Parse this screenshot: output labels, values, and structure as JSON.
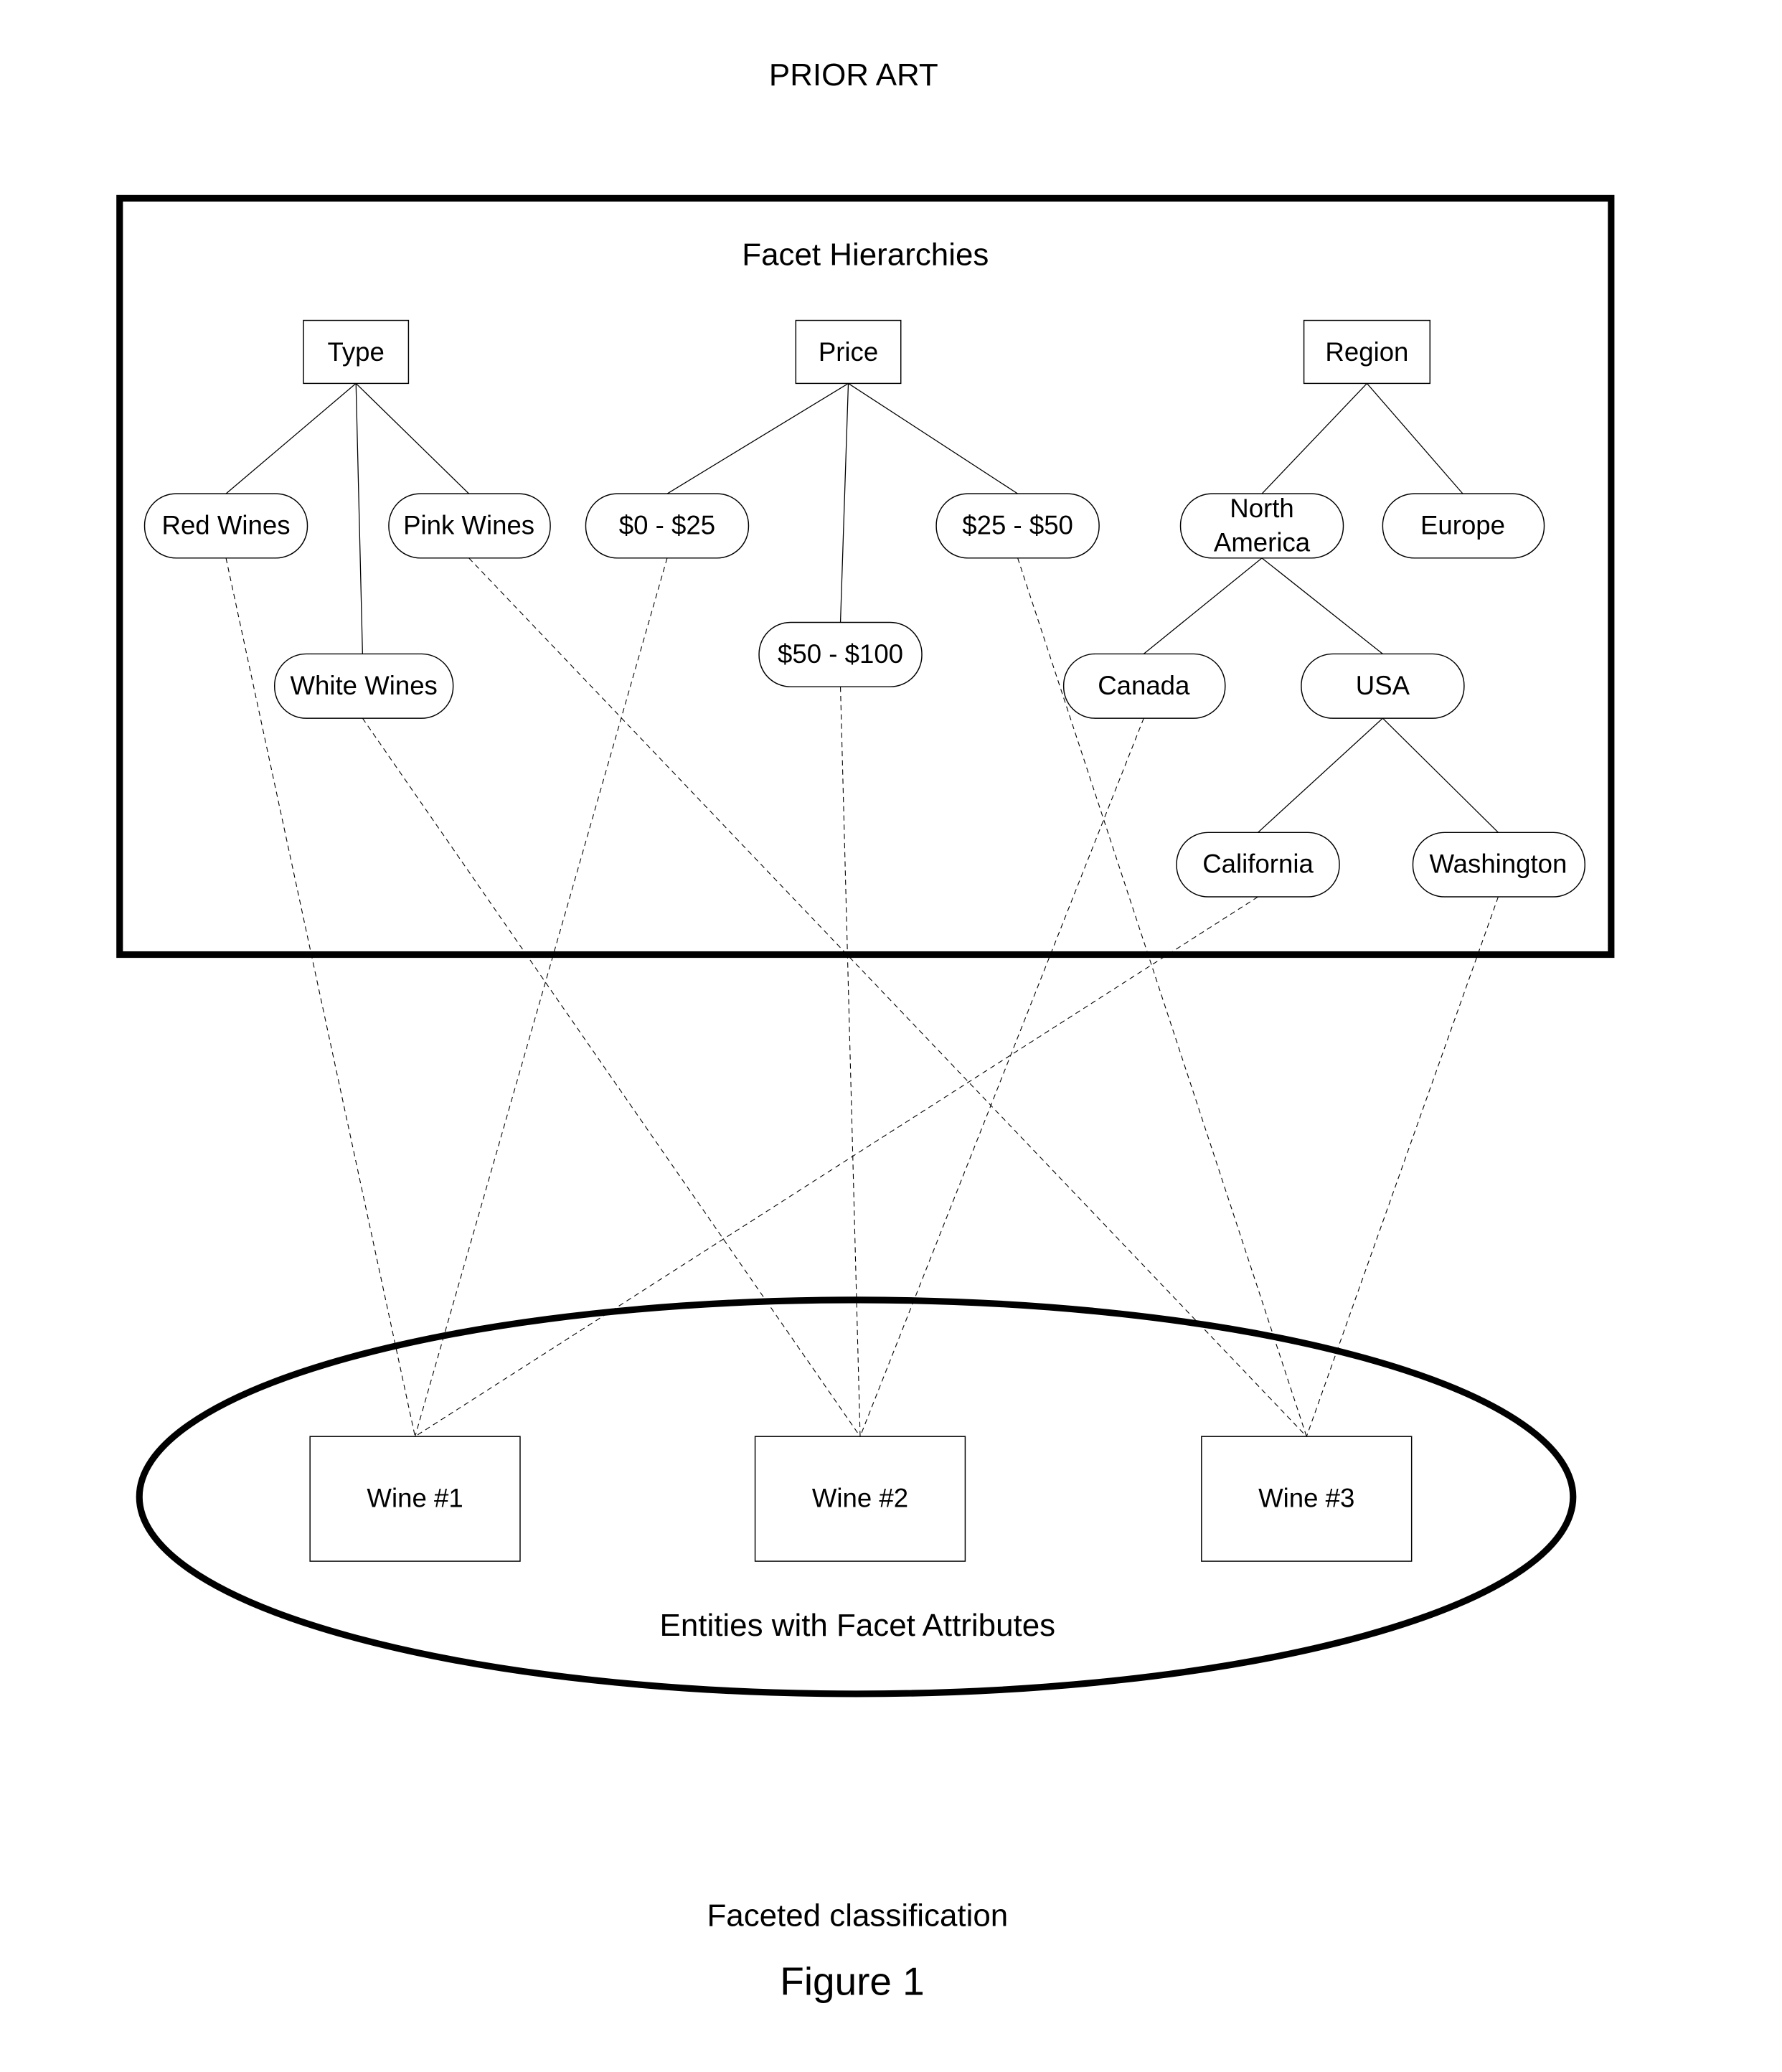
{
  "header": {
    "prior_art": "PRIOR ART"
  },
  "facet_box": {
    "title": "Facet Hierarchies"
  },
  "facets": {
    "type": "Type",
    "price": "Price",
    "region": "Region"
  },
  "values": {
    "red_wines": "Red Wines",
    "pink_wines": "Pink Wines",
    "white_wines": "White Wines",
    "p0_25": "$0 - $25",
    "p25_50": "$25 - $50",
    "p50_100": "$50 - $100",
    "north_america_1": "North",
    "north_america_2": "America",
    "europe": "Europe",
    "canada": "Canada",
    "usa": "USA",
    "california": "California",
    "washington": "Washington"
  },
  "entities": {
    "title": "Entities with Facet Attributes",
    "wine1": "Wine #1",
    "wine2": "Wine #2",
    "wine3": "Wine #3"
  },
  "links": [
    [
      "Wine #1",
      "Red Wines"
    ],
    [
      "Wine #1",
      "$0 - $25"
    ],
    [
      "Wine #1",
      "California"
    ],
    [
      "Wine #2",
      "White Wines"
    ],
    [
      "Wine #2",
      "$50 - $100"
    ],
    [
      "Wine #2",
      "Canada"
    ],
    [
      "Wine #3",
      "Pink Wines"
    ],
    [
      "Wine #3",
      "$25 - $50"
    ],
    [
      "Wine #3",
      "Washington"
    ]
  ],
  "caption": {
    "subtitle": "Faceted classification",
    "figure": "Figure 1"
  }
}
